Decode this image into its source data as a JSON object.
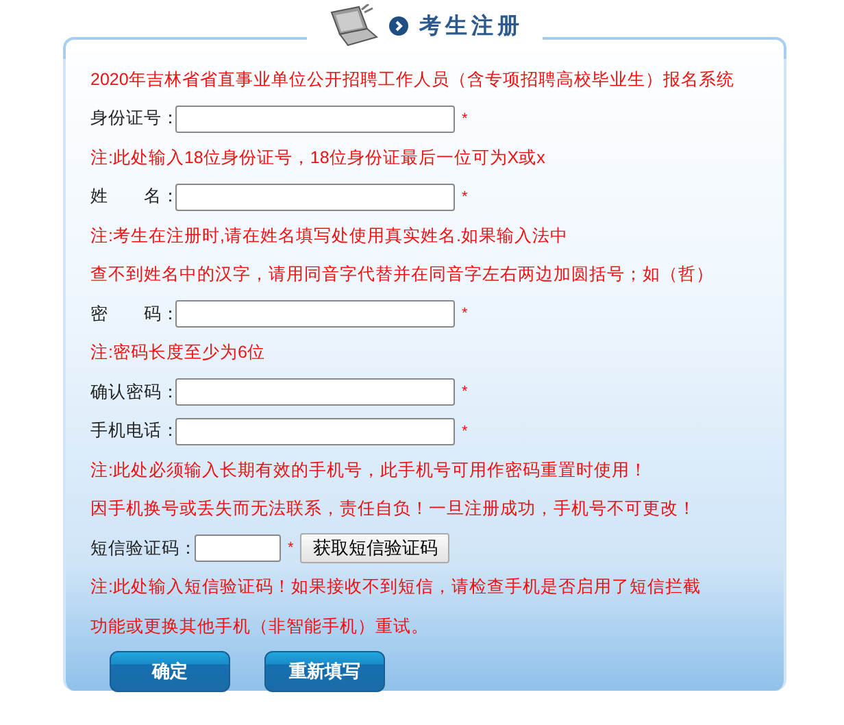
{
  "header": {
    "title": "考生注册"
  },
  "system_title": "2020年吉林省省直事业单位公开招聘工作人员（含专项招聘高校毕业生）报名系统",
  "rows": [
    {
      "kind": "field",
      "label": "身份证号：",
      "required": "*"
    },
    {
      "kind": "note",
      "text": "注:此处输入18位身份证号，18位身份证最后一位可为X或x"
    },
    {
      "kind": "field",
      "label": "姓　　名：",
      "required": "*"
    },
    {
      "kind": "note",
      "text": "注:考生在注册时,请在姓名填写处使用真实姓名.如果输入法中"
    },
    {
      "kind": "note",
      "text": "查不到姓名中的汉字，请用同音字代替并在同音字左右两边加圆括号；如（哲）"
    },
    {
      "kind": "field",
      "label": "密　　码：",
      "required": "*"
    },
    {
      "kind": "note",
      "text": "注:密码长度至少为6位"
    },
    {
      "kind": "field",
      "label": "确认密码：",
      "required": "*"
    },
    {
      "kind": "field",
      "label": "手机电话：",
      "required": "*"
    },
    {
      "kind": "note",
      "text": "注:此处必须输入长期有效的手机号，此手机号可用作密码重置时使用！"
    },
    {
      "kind": "note",
      "text": "因手机换号或丢失而无法联系，责任自负！一旦注册成功，手机号不可更改！"
    },
    {
      "kind": "sms",
      "label": "短信验证码：",
      "required": "*",
      "button": "获取短信验证码"
    },
    {
      "kind": "note",
      "text": "注:此处输入短信验证码！如果接收不到短信，请检查手机是否启用了短信拦截"
    },
    {
      "kind": "note",
      "text": "功能或更换其他手机（非智能手机）重试。"
    }
  ],
  "buttons": [
    "确定",
    "重新填写"
  ]
}
